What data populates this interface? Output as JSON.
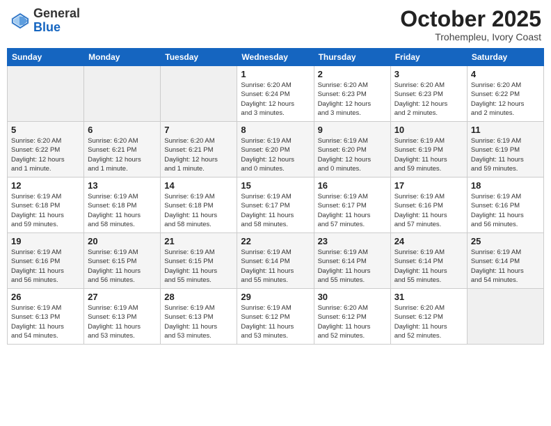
{
  "header": {
    "logo_general": "General",
    "logo_blue": "Blue",
    "month_title": "October 2025",
    "location": "Trohempleu, Ivory Coast"
  },
  "calendar": {
    "days_of_week": [
      "Sunday",
      "Monday",
      "Tuesday",
      "Wednesday",
      "Thursday",
      "Friday",
      "Saturday"
    ],
    "weeks": [
      {
        "cells": [
          {
            "day": "",
            "info": ""
          },
          {
            "day": "",
            "info": ""
          },
          {
            "day": "",
            "info": ""
          },
          {
            "day": "1",
            "info": "Sunrise: 6:20 AM\nSunset: 6:24 PM\nDaylight: 12 hours\nand 3 minutes."
          },
          {
            "day": "2",
            "info": "Sunrise: 6:20 AM\nSunset: 6:23 PM\nDaylight: 12 hours\nand 3 minutes."
          },
          {
            "day": "3",
            "info": "Sunrise: 6:20 AM\nSunset: 6:23 PM\nDaylight: 12 hours\nand 2 minutes."
          },
          {
            "day": "4",
            "info": "Sunrise: 6:20 AM\nSunset: 6:22 PM\nDaylight: 12 hours\nand 2 minutes."
          }
        ]
      },
      {
        "cells": [
          {
            "day": "5",
            "info": "Sunrise: 6:20 AM\nSunset: 6:22 PM\nDaylight: 12 hours\nand 1 minute."
          },
          {
            "day": "6",
            "info": "Sunrise: 6:20 AM\nSunset: 6:21 PM\nDaylight: 12 hours\nand 1 minute."
          },
          {
            "day": "7",
            "info": "Sunrise: 6:20 AM\nSunset: 6:21 PM\nDaylight: 12 hours\nand 1 minute."
          },
          {
            "day": "8",
            "info": "Sunrise: 6:19 AM\nSunset: 6:20 PM\nDaylight: 12 hours\nand 0 minutes."
          },
          {
            "day": "9",
            "info": "Sunrise: 6:19 AM\nSunset: 6:20 PM\nDaylight: 12 hours\nand 0 minutes."
          },
          {
            "day": "10",
            "info": "Sunrise: 6:19 AM\nSunset: 6:19 PM\nDaylight: 11 hours\nand 59 minutes."
          },
          {
            "day": "11",
            "info": "Sunrise: 6:19 AM\nSunset: 6:19 PM\nDaylight: 11 hours\nand 59 minutes."
          }
        ]
      },
      {
        "cells": [
          {
            "day": "12",
            "info": "Sunrise: 6:19 AM\nSunset: 6:18 PM\nDaylight: 11 hours\nand 59 minutes."
          },
          {
            "day": "13",
            "info": "Sunrise: 6:19 AM\nSunset: 6:18 PM\nDaylight: 11 hours\nand 58 minutes."
          },
          {
            "day": "14",
            "info": "Sunrise: 6:19 AM\nSunset: 6:18 PM\nDaylight: 11 hours\nand 58 minutes."
          },
          {
            "day": "15",
            "info": "Sunrise: 6:19 AM\nSunset: 6:17 PM\nDaylight: 11 hours\nand 58 minutes."
          },
          {
            "day": "16",
            "info": "Sunrise: 6:19 AM\nSunset: 6:17 PM\nDaylight: 11 hours\nand 57 minutes."
          },
          {
            "day": "17",
            "info": "Sunrise: 6:19 AM\nSunset: 6:16 PM\nDaylight: 11 hours\nand 57 minutes."
          },
          {
            "day": "18",
            "info": "Sunrise: 6:19 AM\nSunset: 6:16 PM\nDaylight: 11 hours\nand 56 minutes."
          }
        ]
      },
      {
        "cells": [
          {
            "day": "19",
            "info": "Sunrise: 6:19 AM\nSunset: 6:16 PM\nDaylight: 11 hours\nand 56 minutes."
          },
          {
            "day": "20",
            "info": "Sunrise: 6:19 AM\nSunset: 6:15 PM\nDaylight: 11 hours\nand 56 minutes."
          },
          {
            "day": "21",
            "info": "Sunrise: 6:19 AM\nSunset: 6:15 PM\nDaylight: 11 hours\nand 55 minutes."
          },
          {
            "day": "22",
            "info": "Sunrise: 6:19 AM\nSunset: 6:14 PM\nDaylight: 11 hours\nand 55 minutes."
          },
          {
            "day": "23",
            "info": "Sunrise: 6:19 AM\nSunset: 6:14 PM\nDaylight: 11 hours\nand 55 minutes."
          },
          {
            "day": "24",
            "info": "Sunrise: 6:19 AM\nSunset: 6:14 PM\nDaylight: 11 hours\nand 55 minutes."
          },
          {
            "day": "25",
            "info": "Sunrise: 6:19 AM\nSunset: 6:14 PM\nDaylight: 11 hours\nand 54 minutes."
          }
        ]
      },
      {
        "cells": [
          {
            "day": "26",
            "info": "Sunrise: 6:19 AM\nSunset: 6:13 PM\nDaylight: 11 hours\nand 54 minutes."
          },
          {
            "day": "27",
            "info": "Sunrise: 6:19 AM\nSunset: 6:13 PM\nDaylight: 11 hours\nand 53 minutes."
          },
          {
            "day": "28",
            "info": "Sunrise: 6:19 AM\nSunset: 6:13 PM\nDaylight: 11 hours\nand 53 minutes."
          },
          {
            "day": "29",
            "info": "Sunrise: 6:19 AM\nSunset: 6:12 PM\nDaylight: 11 hours\nand 53 minutes."
          },
          {
            "day": "30",
            "info": "Sunrise: 6:20 AM\nSunset: 6:12 PM\nDaylight: 11 hours\nand 52 minutes."
          },
          {
            "day": "31",
            "info": "Sunrise: 6:20 AM\nSunset: 6:12 PM\nDaylight: 11 hours\nand 52 minutes."
          },
          {
            "day": "",
            "info": ""
          }
        ]
      }
    ]
  }
}
